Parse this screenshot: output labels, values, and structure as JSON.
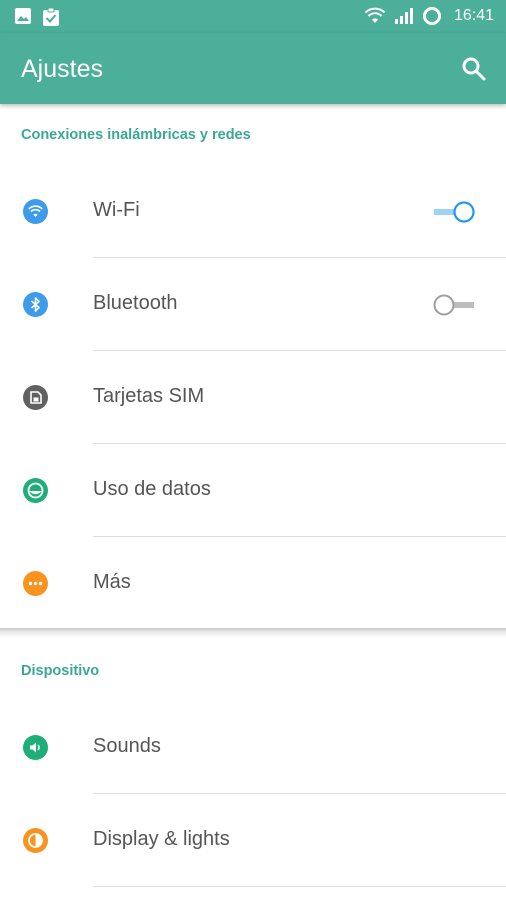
{
  "status_bar": {
    "time": "16:41",
    "left_icons": [
      "image-icon",
      "clipboard-check-icon"
    ],
    "right_icons": [
      "wifi-icon",
      "signal-icon",
      "battery-ring-icon"
    ]
  },
  "app_bar": {
    "title": "Ajustes",
    "search_icon": "search-icon"
  },
  "sections": [
    {
      "header": "Conexiones inalámbricas y redes",
      "items": [
        {
          "label": "Wi-Fi",
          "icon": "wifi-icon",
          "icon_color": "#3d9be9",
          "toggle": true,
          "toggle_on": true
        },
        {
          "label": "Bluetooth",
          "icon": "bluetooth-icon",
          "icon_color": "#3d9be9",
          "toggle": true,
          "toggle_on": false
        },
        {
          "label": "Tarjetas SIM",
          "icon": "sim-card-icon",
          "icon_color": "#616161"
        },
        {
          "label": "Uso de datos",
          "icon": "data-usage-icon",
          "icon_color": "#1fae78"
        },
        {
          "label": "Más",
          "icon": "more-icon",
          "icon_color": "#f7931e"
        }
      ]
    },
    {
      "header": "Dispositivo",
      "items": [
        {
          "label": "Sounds",
          "icon": "sound-icon",
          "icon_color": "#1fae78"
        },
        {
          "label": "Display & lights",
          "icon": "display-icon",
          "icon_color": "#f7931e"
        }
      ]
    }
  ],
  "colors": {
    "primary": "#4caf9a",
    "accent": "#3aa895",
    "toggle_on": "#2196f3"
  }
}
